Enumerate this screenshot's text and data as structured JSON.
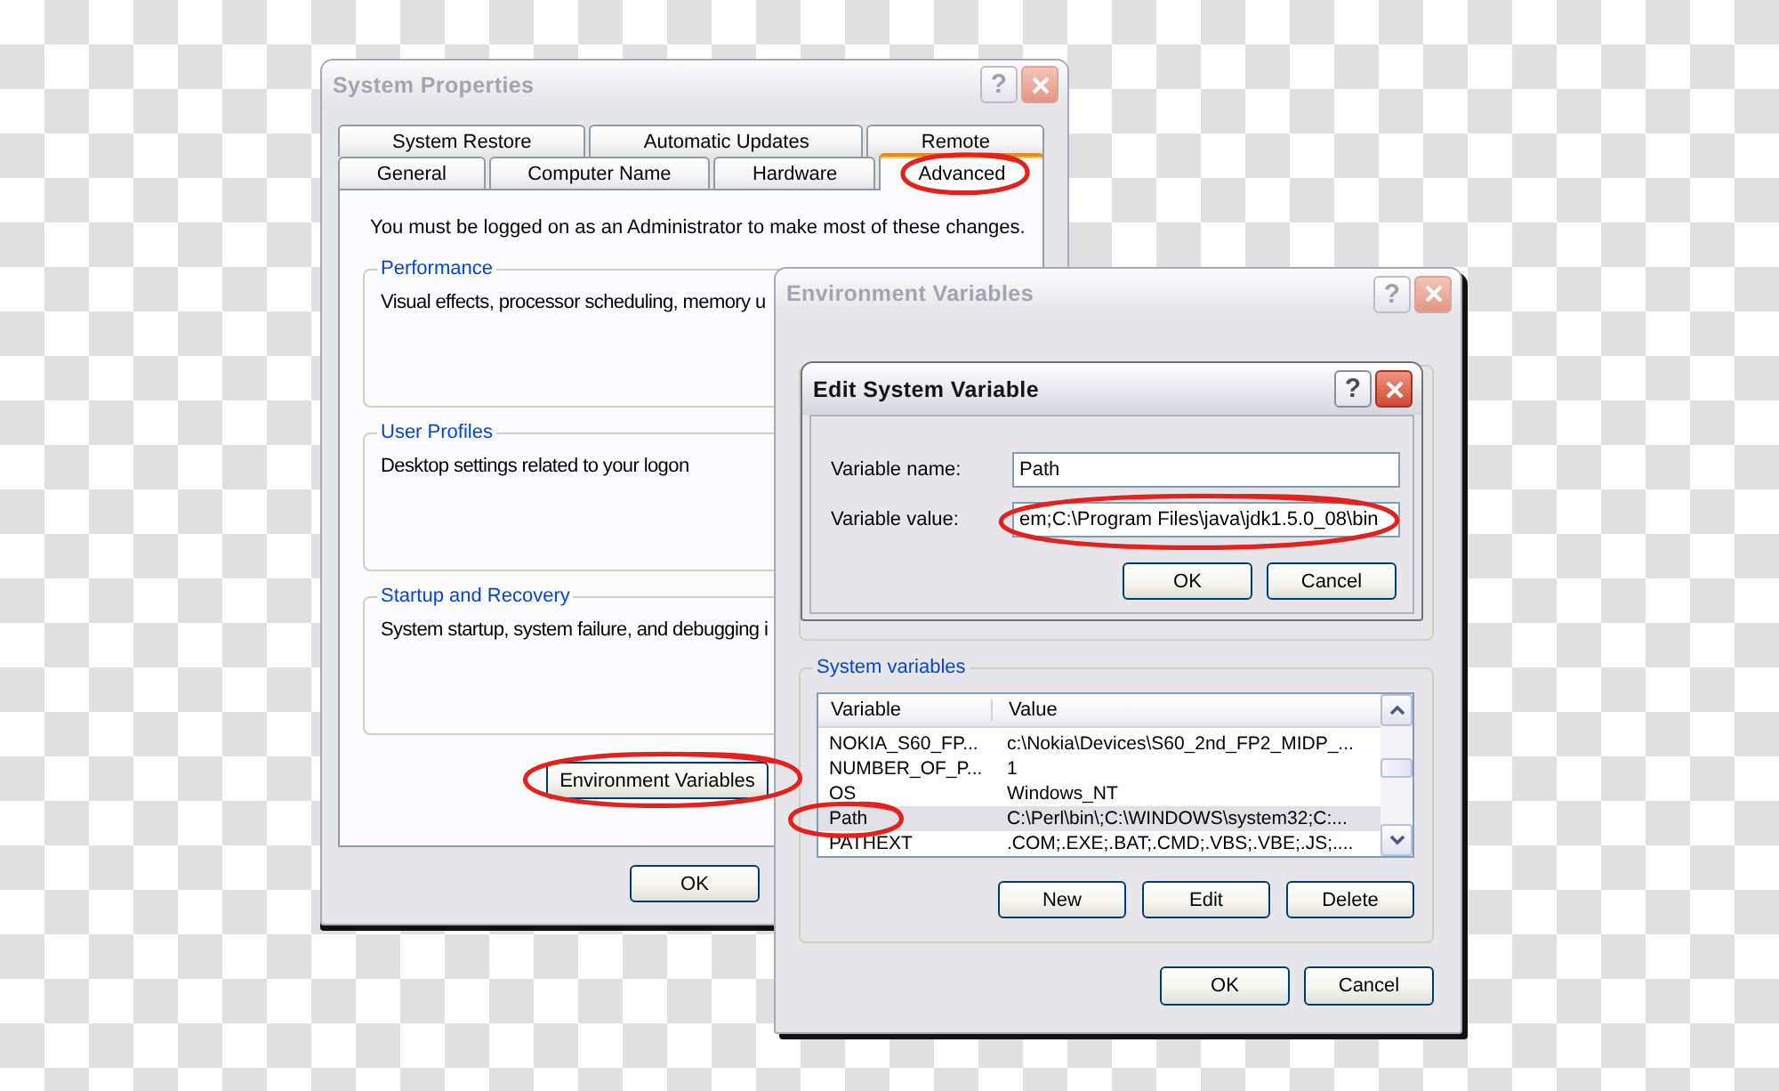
{
  "system_properties": {
    "title": "System Properties",
    "help_button": "?",
    "active": false,
    "tab_rows": [
      {
        "tabs": [
          {
            "label": "System Restore",
            "selected": false,
            "circled": false
          },
          {
            "label": "Automatic Updates",
            "selected": false,
            "circled": false
          },
          {
            "label": "Remote",
            "selected": false,
            "circled": false
          }
        ]
      },
      {
        "tabs": [
          {
            "label": "General",
            "selected": false,
            "circled": false
          },
          {
            "label": "Computer Name",
            "selected": false,
            "circled": false
          },
          {
            "label": "Hardware",
            "selected": false,
            "circled": false
          },
          {
            "label": "Advanced",
            "selected": true,
            "circled": true
          }
        ]
      }
    ],
    "notice": "You must be logged on as an Administrator to make most of these changes.",
    "groups": [
      {
        "title": "Performance",
        "text": "Visual effects, processor scheduling, memory u"
      },
      {
        "title": "User Profiles",
        "text": "Desktop settings related to your logon"
      },
      {
        "title": "Startup and Recovery",
        "text": "System startup, system failure, and debugging i"
      }
    ],
    "panel_button": {
      "label": "Environment Variables",
      "circled": true
    },
    "buttons": [
      {
        "label": "OK"
      }
    ]
  },
  "environment_variables": {
    "title": "Environment Variables",
    "help_button": "?",
    "active": false,
    "system_variables": {
      "title": "System variables",
      "columns": [
        "Variable",
        "Value"
      ],
      "rows": [
        {
          "variable": "NOKIA_S60_FP...",
          "value": "c:\\Nokia\\Devices\\S60_2nd_FP2_MIDP_...",
          "selected": false,
          "circled": false
        },
        {
          "variable": "NUMBER_OF_P...",
          "value": "1",
          "selected": false,
          "circled": false
        },
        {
          "variable": "OS",
          "value": "Windows_NT",
          "selected": false,
          "circled": false
        },
        {
          "variable": "Path",
          "value": "C:\\Perl\\bin\\;C:\\WINDOWS\\system32;C:...",
          "selected": true,
          "circled": true
        },
        {
          "variable": "PATHEXT",
          "value": ".COM;.EXE;.BAT;.CMD;.VBS;.VBE;.JS;....",
          "selected": false,
          "circled": false
        }
      ],
      "buttons": [
        {
          "label": "New"
        },
        {
          "label": "Edit"
        },
        {
          "label": "Delete"
        }
      ]
    },
    "buttons": [
      {
        "label": "OK"
      },
      {
        "label": "Cancel"
      }
    ]
  },
  "edit_system_variable": {
    "title": "Edit System Variable",
    "help_button": "?",
    "active": true,
    "fields": [
      {
        "label": "Variable name:",
        "value": "Path",
        "circled": false
      },
      {
        "label": "Variable value:",
        "value": "em;C:\\Program Files\\java\\jdk1.5.0_08\\bin",
        "circled": true
      }
    ],
    "buttons": [
      {
        "label": "OK"
      },
      {
        "label": "Cancel"
      }
    ]
  }
}
